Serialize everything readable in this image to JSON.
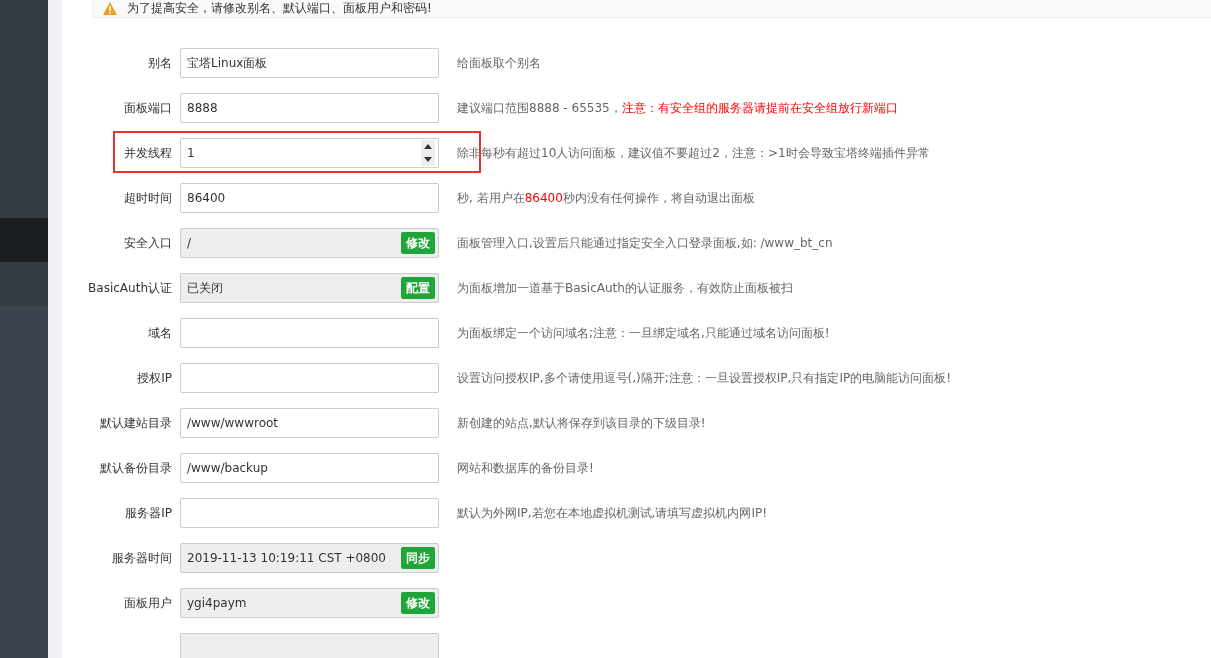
{
  "sidebar": {
    "items": [
      {
        "selected": true
      },
      {
        "selected": false
      }
    ]
  },
  "alert": {
    "text": "为了提高安全，请修改别名、默认端口、面板用户和密码!"
  },
  "rows": [
    {
      "label": "别名",
      "kind": "text",
      "value": "宝塔Linux面板",
      "readonly": false,
      "help": [
        {
          "text": "给面板取个别名",
          "warn": false
        }
      ]
    },
    {
      "label": "面板端口",
      "kind": "text",
      "value": "8888",
      "readonly": false,
      "help": [
        {
          "text": "建议端口范围8888 - 65535，",
          "warn": false
        },
        {
          "text": "注意：有安全组的服务器请提前在安全组放行新端口",
          "warn": true
        }
      ]
    },
    {
      "label": "并发线程",
      "kind": "number",
      "value": "1",
      "readonly": false,
      "highlighted": true,
      "help": [
        {
          "text": "除非每秒有超过10人访问面板，建议值不要超过2，注意：>1时会导致宝塔终端插件异常",
          "warn": false
        }
      ]
    },
    {
      "label": "超时时间",
      "kind": "text",
      "value": "86400",
      "readonly": false,
      "help": [
        {
          "text": "秒, 若用户在",
          "warn": false
        },
        {
          "text": "86400",
          "warn": true
        },
        {
          "text": "秒内没有任何操作，将自动退出面板",
          "warn": false
        }
      ]
    },
    {
      "label": "安全入口",
      "kind": "text",
      "value": "/",
      "readonly": true,
      "button": "修改",
      "help": [
        {
          "text": "面板管理入口,设置后只能通过指定安全入口登录面板,如: /www_bt_cn",
          "warn": false
        }
      ]
    },
    {
      "label": "BasicAuth认证",
      "kind": "text",
      "value": "已关闭",
      "readonly": true,
      "button": "配置",
      "help": [
        {
          "text": "为面板增加一道基于BasicAuth的认证服务，有效防止面板被扫",
          "warn": false
        }
      ]
    },
    {
      "label": "域名",
      "kind": "text",
      "readonly": false,
      "help": [
        {
          "text": "为面板绑定一个访问域名;注意：一旦绑定域名,只能通过域名访问面板!",
          "warn": false
        }
      ]
    },
    {
      "label": "授权IP",
      "kind": "text",
      "readonly": false,
      "help": [
        {
          "text": "设置访问授权IP,多个请使用逗号(,)隔开;注意：一旦设置授权IP,只有指定IP的电脑能访问面板!",
          "warn": false
        }
      ]
    },
    {
      "label": "默认建站目录",
      "kind": "text",
      "value": "/www/wwwroot",
      "readonly": false,
      "help": [
        {
          "text": "新创建的站点,默认将保存到该目录的下级目录!",
          "warn": false
        }
      ]
    },
    {
      "label": "默认备份目录",
      "kind": "text",
      "value": "/www/backup",
      "readonly": false,
      "help": [
        {
          "text": "网站和数据库的备份目录!",
          "warn": false
        }
      ]
    },
    {
      "label": "服务器IP",
      "kind": "redacted",
      "readonly": false,
      "help": [
        {
          "text": "默认为外网IP,若您在本地虚拟机测试,请填写虚拟机内网IP!",
          "warn": false
        }
      ]
    },
    {
      "label": "服务器时间",
      "kind": "text",
      "value": "2019-11-13 10:19:11 CST +0800",
      "readonly": true,
      "button": "同步"
    },
    {
      "label": "面板用户",
      "kind": "text",
      "value": "ygi4paym",
      "readonly": true,
      "button": "修改"
    },
    {
      "kind": "text",
      "readonly": true
    }
  ]
}
